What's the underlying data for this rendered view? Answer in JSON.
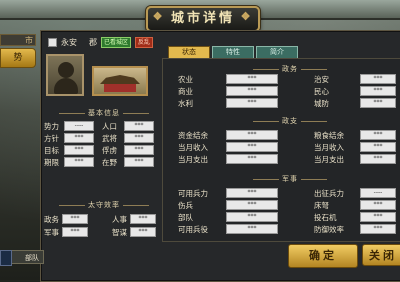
{
  "title": "城市详情",
  "left_nav": {
    "top_label": "市",
    "button_label": "势"
  },
  "header": {
    "city_name": "永安",
    "subtitle": "郡",
    "tag_green": "已看城区",
    "tag_red": "反乱"
  },
  "basic_info": {
    "title": "基本信息",
    "rows": [
      {
        "l_label": "势力",
        "l_value": "----",
        "r_label": "人口",
        "r_value": "***"
      },
      {
        "l_label": "方针",
        "l_value": "***",
        "r_label": "武将",
        "r_value": "***"
      },
      {
        "l_label": "目标",
        "l_value": "***",
        "r_label": "俘虏",
        "r_value": "***"
      },
      {
        "l_label": "期限",
        "l_value": "***",
        "r_label": "在野",
        "r_value": "***"
      }
    ]
  },
  "officials": {
    "title": "太守效率",
    "rows": [
      {
        "l_label": "政务",
        "l_value": "***",
        "r_label": "人事",
        "r_value": "***"
      },
      {
        "l_label": "军事",
        "l_value": "***",
        "r_label": "智谋",
        "r_value": "***"
      }
    ]
  },
  "tabs": [
    {
      "label": "状态"
    },
    {
      "label": "特性"
    },
    {
      "label": "简介"
    }
  ],
  "politics": {
    "title": "政务",
    "rows": [
      {
        "l_label": "农业",
        "l_value": "***",
        "r_label": "治安",
        "r_value": "***"
      },
      {
        "l_label": "商业",
        "l_value": "***",
        "r_label": "民心",
        "r_value": "***"
      },
      {
        "l_label": "水利",
        "l_value": "***",
        "r_label": "城防",
        "r_value": "***"
      }
    ]
  },
  "finance": {
    "title": "政支",
    "rows": [
      {
        "l_label": "资金结余",
        "l_value": "***",
        "r_label": "粮食结余",
        "r_value": "***"
      },
      {
        "l_label": "当月收入",
        "l_value": "***",
        "r_label": "当月收入",
        "r_value": "***"
      },
      {
        "l_label": "当月支出",
        "l_value": "***",
        "r_label": "当月支出",
        "r_value": "***"
      }
    ]
  },
  "military": {
    "title": "军事",
    "rows": [
      {
        "l_label": "可用兵力",
        "l_value": "***",
        "r_label": "出征兵力",
        "r_value": "----"
      },
      {
        "l_label": "伤兵",
        "l_value": "***",
        "r_label": "床弩",
        "r_value": "***"
      },
      {
        "l_label": "部队",
        "l_value": "***",
        "r_label": "投石机",
        "r_value": "***"
      },
      {
        "l_label": "可用兵役",
        "l_value": "***",
        "r_label": "防御效率",
        "r_value": "***"
      }
    ]
  },
  "buttons": {
    "ok": "确定",
    "close": "关闭"
  },
  "bottom": {
    "tab_label": "部队"
  }
}
